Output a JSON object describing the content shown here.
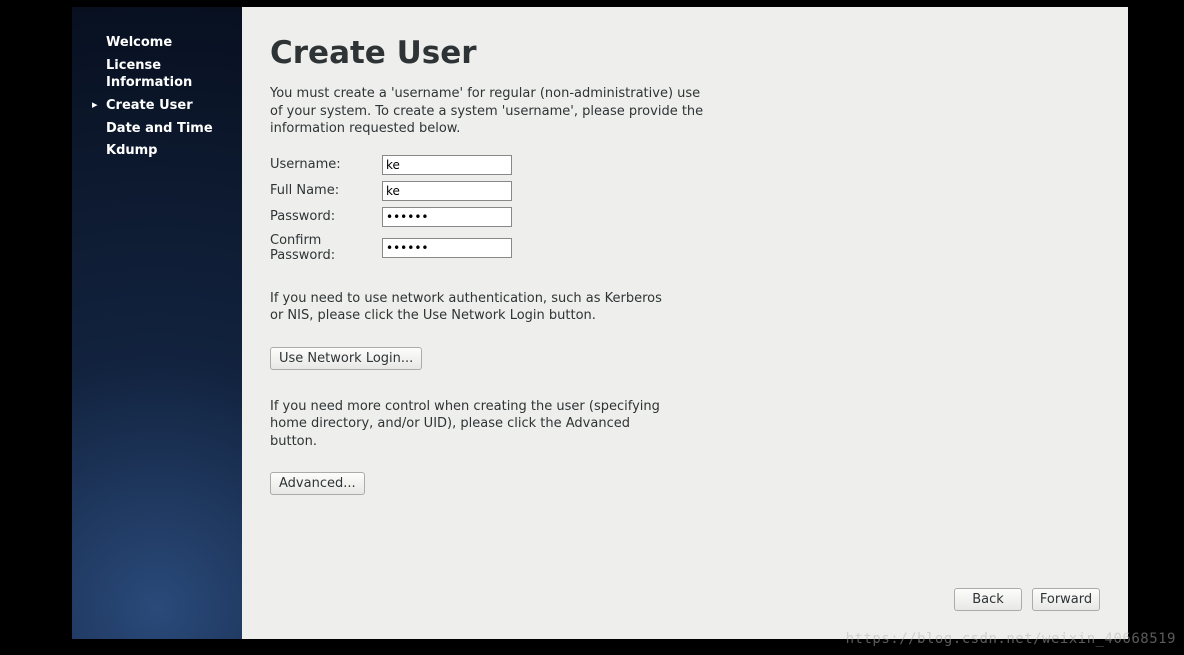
{
  "sidebar": {
    "items": [
      {
        "label": "Welcome",
        "current": false
      },
      {
        "label": "License Information",
        "current": false
      },
      {
        "label": "Create User",
        "current": true
      },
      {
        "label": "Date and Time",
        "current": false
      },
      {
        "label": "Kdump",
        "current": false
      }
    ]
  },
  "main": {
    "title": "Create User",
    "description": "You must create a 'username' for regular (non-administrative) use of your system.  To create a system 'username', please provide the information requested below.",
    "form": {
      "username_label": "Username:",
      "username_value": "ke",
      "fullname_label": "Full Name:",
      "fullname_value": "ke",
      "password_label": "Password:",
      "password_value": "••••••",
      "confirm_label": "Confirm Password:",
      "confirm_value": "••••••"
    },
    "network_info": "If you need to use network authentication, such as Kerberos or NIS, please click the Use Network Login button.",
    "network_button": "Use Network Login...",
    "advanced_info": "If you need more control when creating the user (specifying home directory, and/or UID), please click the Advanced button.",
    "advanced_button": "Advanced..."
  },
  "footer": {
    "back": "Back",
    "forward": "Forward"
  },
  "watermark": "https://blog.csdn.net/weixin_40668519"
}
